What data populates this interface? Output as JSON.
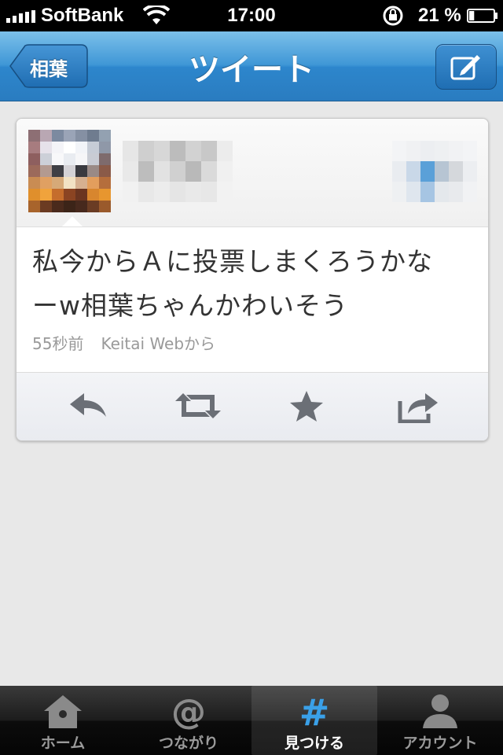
{
  "status_bar": {
    "carrier": "SoftBank",
    "time": "17:00",
    "battery_percent": "21 %",
    "battery_level": 0.21
  },
  "nav": {
    "back_label": "相葉",
    "title": "ツイート",
    "compose_icon": "compose-icon"
  },
  "tweet": {
    "text_line1": "私今からＡに投票しまくろうかな",
    "text_line2": "ーw相葉ちゃんかわいそう",
    "time_ago": "55秒前",
    "source": "Keitai Webから"
  },
  "actions": [
    {
      "icon": "reply-icon"
    },
    {
      "icon": "retweet-icon"
    },
    {
      "icon": "favorite-star-icon"
    },
    {
      "icon": "share-icon"
    }
  ],
  "tabs": [
    {
      "label": "ホーム",
      "icon": "home-icon",
      "active": false
    },
    {
      "label": "つながり",
      "icon": "at-icon",
      "active": false
    },
    {
      "label": "見つける",
      "icon": "hash-icon",
      "active": true
    },
    {
      "label": "アカウント",
      "icon": "person-icon",
      "active": false
    }
  ],
  "colors": {
    "nav_blue": "#3f97d6",
    "active_tab_icon": "#3aa0e8"
  }
}
